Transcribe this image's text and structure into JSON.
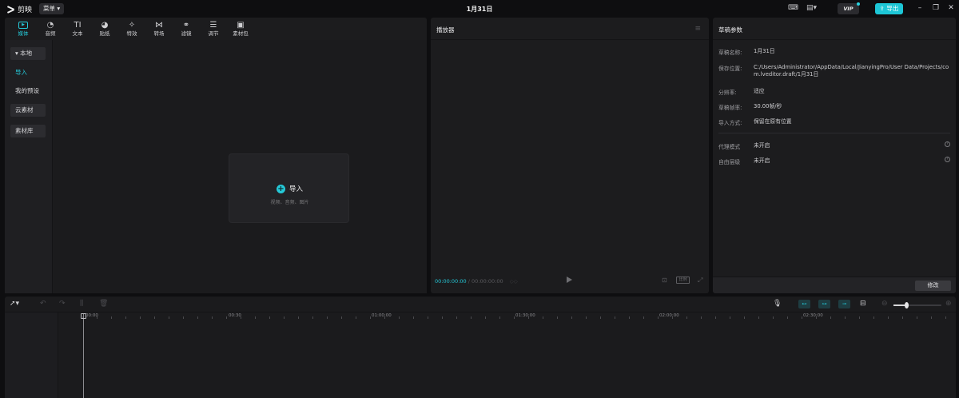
{
  "app": {
    "name": "剪映",
    "menu_label": "菜单",
    "window_title": "1月31日",
    "vip_label": "VIP",
    "export_label": "导出"
  },
  "media": {
    "tabs": [
      {
        "label": "媒体",
        "icon": "media-icon"
      },
      {
        "label": "音频",
        "icon": "audio-icon"
      },
      {
        "label": "文本",
        "icon": "text-icon",
        "glyph": "TI"
      },
      {
        "label": "贴纸",
        "icon": "sticker-icon"
      },
      {
        "label": "特效",
        "icon": "effects-icon"
      },
      {
        "label": "转场",
        "icon": "transition-icon"
      },
      {
        "label": "滤镜",
        "icon": "filter-icon"
      },
      {
        "label": "调节",
        "icon": "adjust-icon"
      },
      {
        "label": "素材包",
        "icon": "material-pack-icon"
      }
    ],
    "sidebar": {
      "local": "本地",
      "import": "导入",
      "my_presets": "我的预设",
      "cloud": "云素材",
      "library": "素材库"
    },
    "import_box": {
      "label": "导入",
      "hint": "视频、音频、图片"
    }
  },
  "player": {
    "title": "播放器",
    "current_time": "00:00:00:00",
    "total_time": "00:00:00:00",
    "ratio_label": "比例"
  },
  "props": {
    "title": "草稿参数",
    "rows": [
      {
        "key": "草稿名称:",
        "value": "1月31日"
      },
      {
        "key": "保存位置:",
        "value": "C:/Users/Administrator/AppData/Local/JianyingPro/User Data/Projects/com.lveditor.draft/1月31日"
      },
      {
        "key": "分辨率:",
        "value": "适应"
      },
      {
        "key": "草稿帧率:",
        "value": "30.00帧/秒"
      },
      {
        "key": "导入方式:",
        "value": "保留在原有位置"
      },
      {
        "key": "代理模式",
        "value": "未开启"
      },
      {
        "key": "自由层级",
        "value": "未开启"
      }
    ],
    "modify_label": "修改"
  },
  "timeline": {
    "ruler": [
      "00:00",
      "00:30",
      "01:00:00",
      "01:30:00",
      "02:00:00",
      "02:30:00"
    ]
  },
  "colors": {
    "accent": "#25c9d8",
    "panel": "#1c1c1e",
    "background": "#0e0e10"
  }
}
